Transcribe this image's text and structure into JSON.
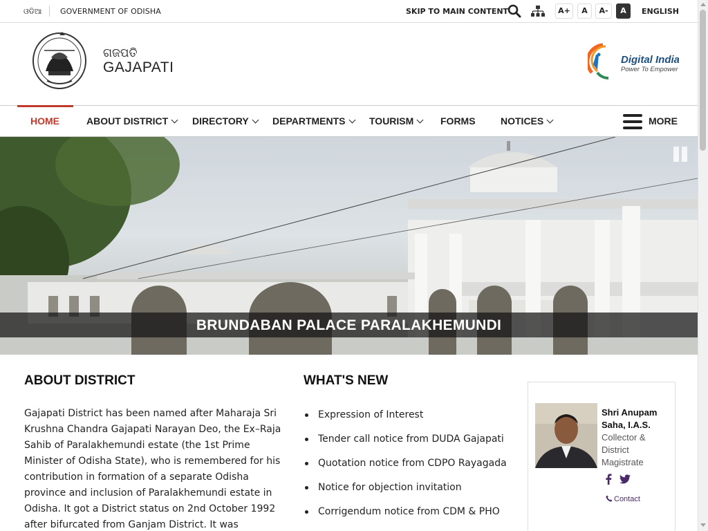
{
  "topbar": {
    "language_odia": "ଓଡିଆ",
    "government": "GOVERNMENT OF ODISHA",
    "skip_link": "SKIP TO MAIN CONTENT",
    "font_increase": "A+",
    "font_normal": "A",
    "font_decrease": "A-",
    "high_contrast": "A",
    "language_english": "ENGLISH",
    "icons": [
      "search-icon",
      "sitemap-icon"
    ]
  },
  "header": {
    "site_name_odia": "ଗଜପତି",
    "site_name": "GAJAPATI",
    "digital_india_title": "Digital India",
    "digital_india_tagline": "Power To Empower"
  },
  "nav": {
    "items": [
      {
        "label": "HOME",
        "active": true,
        "has_dropdown": false
      },
      {
        "label": "ABOUT DISTRICT",
        "active": false,
        "has_dropdown": true
      },
      {
        "label": "DIRECTORY",
        "active": false,
        "has_dropdown": true
      },
      {
        "label": "DEPARTMENTS",
        "active": false,
        "has_dropdown": true
      },
      {
        "label": "TOURISM",
        "active": false,
        "has_dropdown": true
      },
      {
        "label": "FORMS",
        "active": false,
        "has_dropdown": false
      },
      {
        "label": "NOTICES",
        "active": false,
        "has_dropdown": true
      }
    ],
    "more_label": "MORE",
    "active_color": "#c0392b"
  },
  "banner": {
    "caption": "BRUNDABAN PALACE PARALAKHEMUNDI"
  },
  "about": {
    "title": "ABOUT DISTRICT",
    "text": "Gajapati District has been named after Maharaja Sri Krushna Chandra Gajapati Narayan Deo, the Ex–Raja Sahib of Paralakhemundi estate (the 1st Prime Minister of Odisha State), who is remembered for his contribution in formation of a separate Odisha province and inclusion of Paralakhemundi estate in Odisha. It got a District status on 2nd October 1992 after bifurcated from Ganjam District. It was"
  },
  "whats_new": {
    "title": "WHAT'S NEW",
    "items": [
      "Expression of Interest",
      "Tender call notice from DUDA Gajapati",
      "Quotation notice from CDPO Rayagada",
      "Notice for objection invitation",
      "Corrigendum notice from CDM & PHO"
    ]
  },
  "profile": {
    "name": "Shri Anupam Saha, I.A.S.",
    "designation": "Collector & District Magistrate",
    "contact_label": "Contact",
    "social": [
      "facebook-icon",
      "twitter-icon"
    ],
    "link_color": "#4b2a6b"
  }
}
